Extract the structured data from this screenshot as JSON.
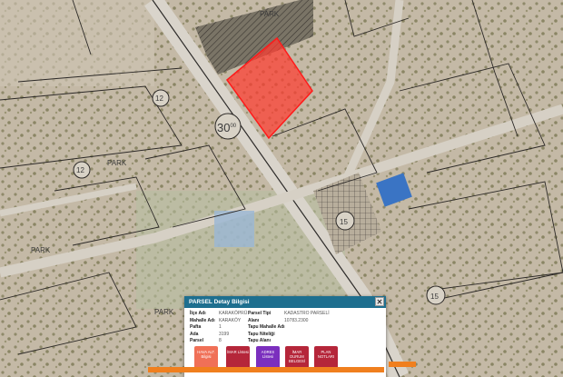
{
  "map": {
    "road_label": "30",
    "road_label_sup": "00",
    "park_labels": [
      "PARK",
      "PARK",
      "PARK",
      "PARK"
    ],
    "circle_labels": [
      "12",
      "12",
      "15",
      "15"
    ],
    "highlight_color": "#ff3b30"
  },
  "popup": {
    "title": "PARSEL Detay Bilgisi",
    "close_label": "✕",
    "rows": [
      {
        "label": "İlçe Adı",
        "value": "KARAKÖPRÜ",
        "label2": "Parsel Tipi",
        "value2": "KADASTRO PARSELİ"
      },
      {
        "label": "Mahalle Adı",
        "value": "KARAKÖY",
        "label2": "Alanı",
        "value2": "10783.2300"
      },
      {
        "label": "Pafta",
        "value": "1",
        "label2": "Tapu Mahalle Adı",
        "value2": ""
      },
      {
        "label": "Ada",
        "value": "3199",
        "label2": "Tapu Niteliği",
        "value2": ""
      },
      {
        "label": "Parsel",
        "value": "8",
        "label2": "Tapu Alanı",
        "value2": ""
      }
    ],
    "buttons": [
      {
        "label": "HAVA ALT. Bilgisi",
        "color": "#f07057"
      },
      {
        "label": "İMAR Lİstesi",
        "color": "#b5263a"
      },
      {
        "label": "ADRES Lİstesi",
        "color": "#7b2fbe"
      },
      {
        "label": "İMAR DURUM BELGESİ",
        "color": "#b5263a"
      },
      {
        "label": "PLAN NOTLARI",
        "color": "#b5263a"
      }
    ]
  }
}
